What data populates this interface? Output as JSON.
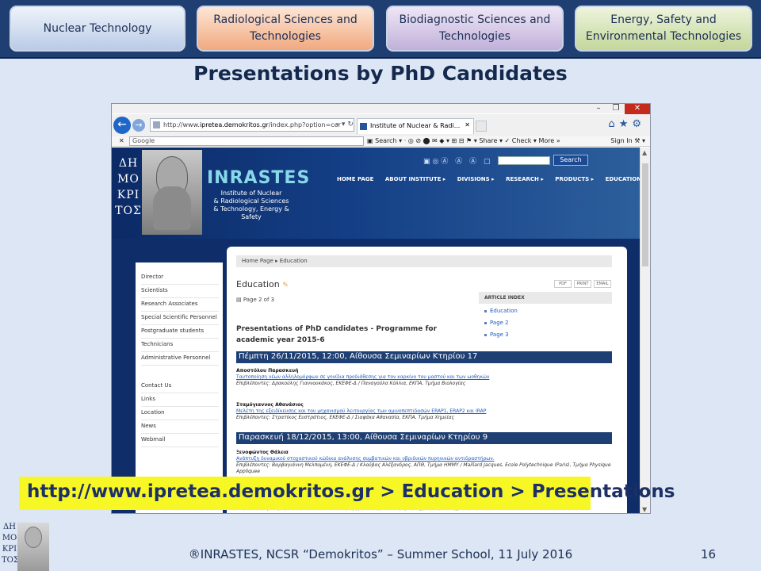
{
  "top_tabs": [
    "Nuclear Technology",
    "Radiological Sciences and Technologies",
    "Biodiagnostic Sciences and Technologies",
    "Energy, Safety and Environmental Technologies"
  ],
  "slide_title": "Presentations by PhD Candidates",
  "browser": {
    "address_prefix": "http://www.",
    "address_domain": "ipretea.demokritos.gr",
    "address_suffix": "/index.php?option=cor",
    "tab_title": "Institute of Nuclear & Radi...",
    "google_label": "Google",
    "toolbar_search": "Search",
    "toolbar_share": "Share",
    "toolbar_check": "Check",
    "toolbar_more": "More »",
    "sign_in": "Sign In"
  },
  "site": {
    "logo_letters": [
      "ΔΗ",
      "ΜΟ",
      "ΚΡΙ",
      "ΤΟΣ"
    ],
    "name": "INRASTES",
    "subtitle": [
      "Institute of Nuclear",
      "& Radiological Sciences",
      "& Technology, Energy & Safety"
    ],
    "search_button": "Search",
    "menu": [
      "HOME PAGE",
      "ABOUT INSTITUTE ▸",
      "DIVISIONS ▸",
      "RESEARCH ▸",
      "PRODUCTS ▸",
      "EDUCATION"
    ]
  },
  "sidebar": {
    "items": [
      "Director",
      "Scientists",
      "Research Associates",
      "Special Scientific Personnel",
      "Postgraduate students",
      "Technicians",
      "Administrative Personnel",
      "Contact Us",
      "Links",
      "Location",
      "News",
      "Webmail"
    ]
  },
  "content": {
    "breadcrumb": "Home Page  ▸  Education",
    "title": "Education",
    "tools": [
      "PDF",
      "PRINT",
      "EMAIL"
    ],
    "page_of": "Page 2 of 3",
    "article_index": {
      "heading": "ARTICLE INDEX",
      "links": [
        "Education",
        "Page 2",
        "Page 3"
      ]
    },
    "heading": "Presentations of PhD candidates - Programme for academic year 2015-6",
    "sessions": [
      {
        "date": "Πέμπτη 26/11/2015, 12:00, Αίθουσα Σεμιναρίων Κτηρίου 17",
        "entries": [
          {
            "name": "Αποστόλου Παρασκευή",
            "title": "Ταυτοποίηση νέων αλληλομόρφων σε γονίδια προδιάθεσης για τον καρκίνο του μαστού και των ωοθηκών",
            "supervisors": "Επιβλέποντες: Δρακούλης Γιαννουκάκος, ΕΚΕΦΕ-Δ / Παναγούλα Κόλλια, ΕΚΠΑ, Τμήμα Βιολογίας"
          },
          {
            "name": "Σταμόγιαννος Αθανάσιος",
            "title": "Μελέτη της εξειδίκευσης και του μηχανισμού λειτουργίας των αμινοπεπτιδασών ERAP1, ERAP2 και IRAP",
            "supervisors": "Επιβλέποντες: Στρατίκος Ευστράτιος, ΕΚΕΦΕ-Δ / Σιαφάκα Αθανασία, ΕΚΠΑ, Τμήμα Χημείας"
          }
        ]
      },
      {
        "date": "Παρασκευή 18/12/2015, 13:00, Αίθουσα Σεμιναρίων Κτηρίου 9",
        "entries": [
          {
            "name": "Ξενοφώντος Θάλεια",
            "title": "Ανάπτυξη δυναμικού στοχαστικού κώδικα ανάλυσης συμβατικών και υβριδικών πυρηνικών αντιδραστήρων.",
            "supervisors": "Επιβλέποντες: Βαρβαγιάννη Μελπομένη, ΕΚΕΦΕ-Δ / Κλούβας Αλέξανδρος, ΑΠΘ, Τμήμα ΗΜΜΥ / Maillard Jacques, Ecole Polytechnique (Paris), Τμήμα Physique Appliquee"
          }
        ]
      }
    ],
    "last_supervisors": "Επιβλέποντες: Σαραγά Δικαία, ΕΚΕΦΕ-Δ / Μπάρτζης Ιωάννης ΠΔΜ, Τμήμα Μηχανολόγων Μηχανικών"
  },
  "url_highlight": "http://www.ipretea.demokritos.gr > Education > Presentations",
  "footer": {
    "logo_letters": [
      "ΔΗ",
      "ΜΟ",
      "ΚΡΙ",
      "ΤΟΣ"
    ],
    "text": "®INRASTES, NCSR “Demokritos” – Summer School, 11 July 2016",
    "page_number": "16"
  }
}
